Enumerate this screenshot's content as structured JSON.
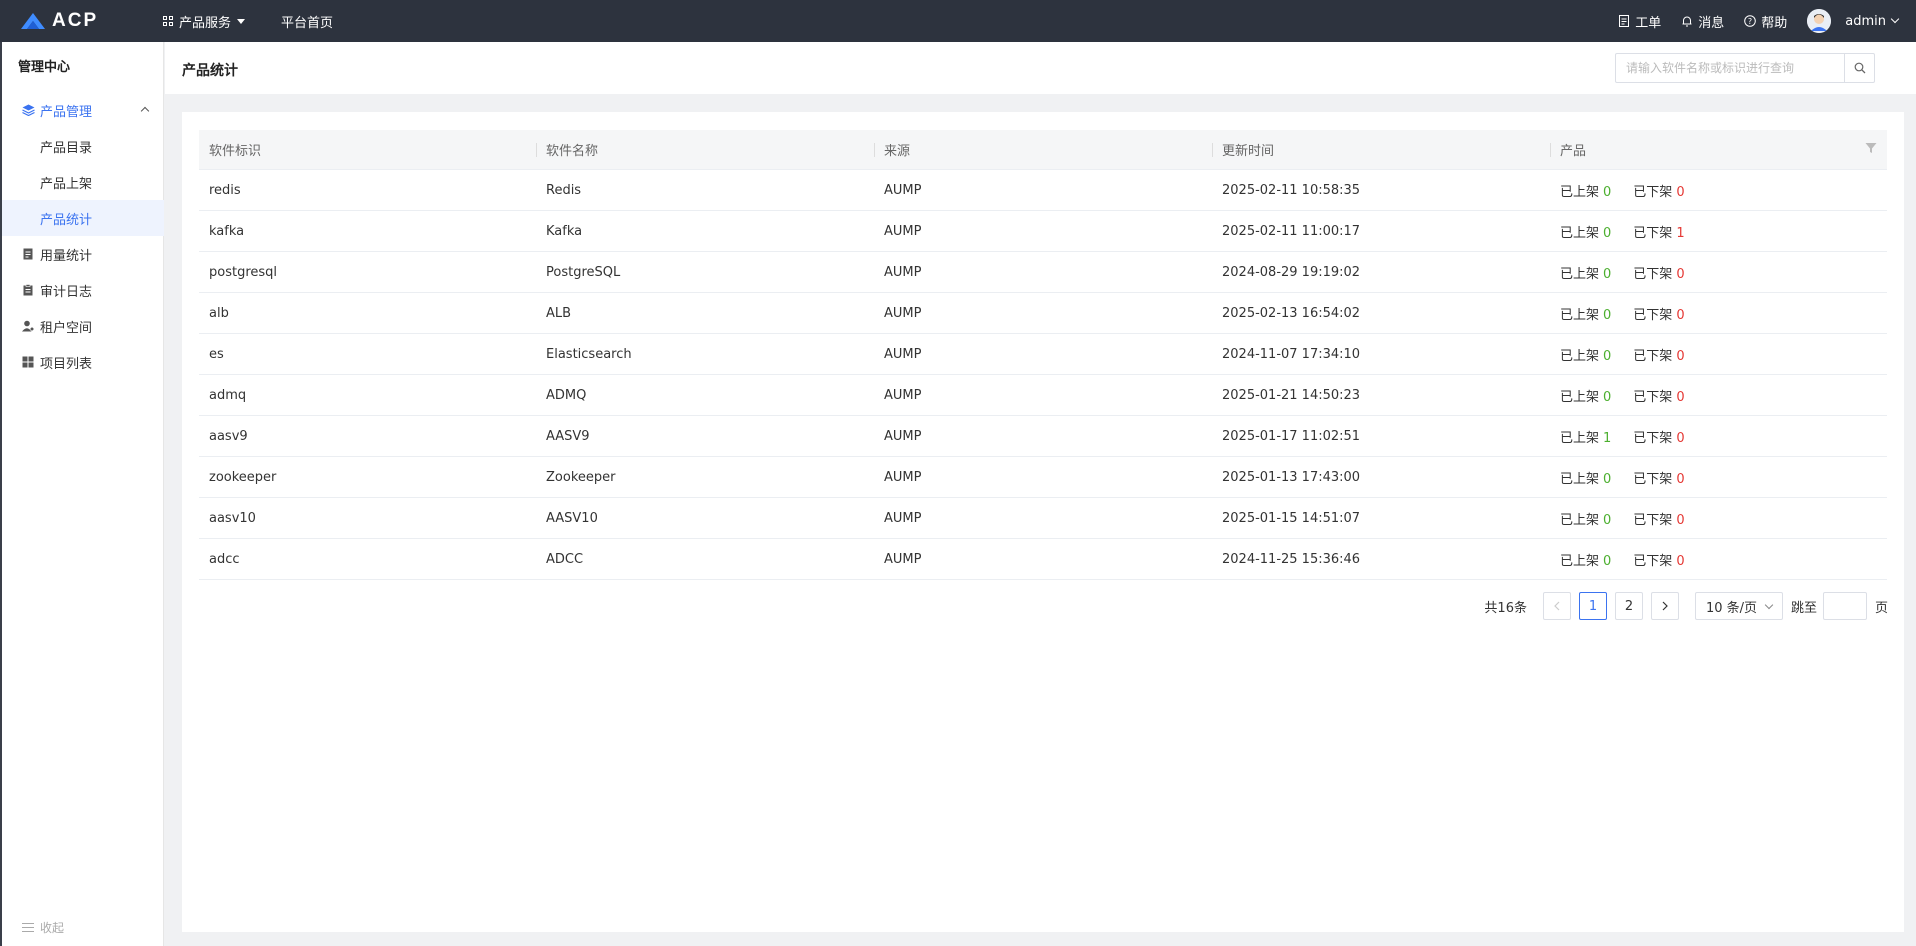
{
  "topbar": {
    "logo_text": "ACP",
    "services_label": "产品服务",
    "home_label": "平台首页",
    "ticket_label": "工单",
    "message_label": "消息",
    "help_label": "帮助",
    "user_name": "admin"
  },
  "sidebar": {
    "title": "管理中心",
    "group_label": "产品管理",
    "sub_items": [
      {
        "label": "产品目录"
      },
      {
        "label": "产品上架"
      },
      {
        "label": "产品统计"
      }
    ],
    "items": [
      {
        "label": "用量统计",
        "icon": "report-icon"
      },
      {
        "label": "审计日志",
        "icon": "clipboard-icon"
      },
      {
        "label": "租户空间",
        "icon": "user-cog-icon"
      },
      {
        "label": "项目列表",
        "icon": "grid-icon"
      }
    ],
    "collapse_label": "收起"
  },
  "header": {
    "title": "产品统计",
    "search_placeholder": "请输入软件名称或标识进行查询"
  },
  "table": {
    "columns": [
      "软件标识",
      "软件名称",
      "来源",
      "更新时间",
      "产品"
    ],
    "listed_label": "已上架",
    "unlisted_label": "已下架",
    "rows": [
      {
        "id": "redis",
        "name": "Redis",
        "source": "AUMP",
        "updated": "2025-02-11 10:58:35",
        "listed": "0",
        "unlisted": "0"
      },
      {
        "id": "kafka",
        "name": "Kafka",
        "source": "AUMP",
        "updated": "2025-02-11 11:00:17",
        "listed": "0",
        "unlisted": "1"
      },
      {
        "id": "postgresql",
        "name": "PostgreSQL",
        "source": "AUMP",
        "updated": "2024-08-29 19:19:02",
        "listed": "0",
        "unlisted": "0"
      },
      {
        "id": "alb",
        "name": "ALB",
        "source": "AUMP",
        "updated": "2025-02-13 16:54:02",
        "listed": "0",
        "unlisted": "0"
      },
      {
        "id": "es",
        "name": "Elasticsearch",
        "source": "AUMP",
        "updated": "2024-11-07 17:34:10",
        "listed": "0",
        "unlisted": "0"
      },
      {
        "id": "admq",
        "name": "ADMQ",
        "source": "AUMP",
        "updated": "2025-01-21 14:50:23",
        "listed": "0",
        "unlisted": "0"
      },
      {
        "id": "aasv9",
        "name": "AASV9",
        "source": "AUMP",
        "updated": "2025-01-17 11:02:51",
        "listed": "1",
        "unlisted": "0"
      },
      {
        "id": "zookeeper",
        "name": "Zookeeper",
        "source": "AUMP",
        "updated": "2025-01-13 17:43:00",
        "listed": "0",
        "unlisted": "0"
      },
      {
        "id": "aasv10",
        "name": "AASV10",
        "source": "AUMP",
        "updated": "2025-01-15 14:51:07",
        "listed": "0",
        "unlisted": "0"
      },
      {
        "id": "adcc",
        "name": "ADCC",
        "source": "AUMP",
        "updated": "2024-11-25 15:36:46",
        "listed": "0",
        "unlisted": "0"
      }
    ]
  },
  "pagination": {
    "total_label": "共16条",
    "pages": [
      "1",
      "2"
    ],
    "current_page": "1",
    "page_size": "10 条/页",
    "jump_label": "跳至",
    "page_suffix": "页",
    "jump_value": ""
  },
  "colors": {
    "topbar_bg": "#2d333e",
    "accent": "#3b73f0",
    "green": "#4caf2f",
    "red": "#e53935"
  }
}
